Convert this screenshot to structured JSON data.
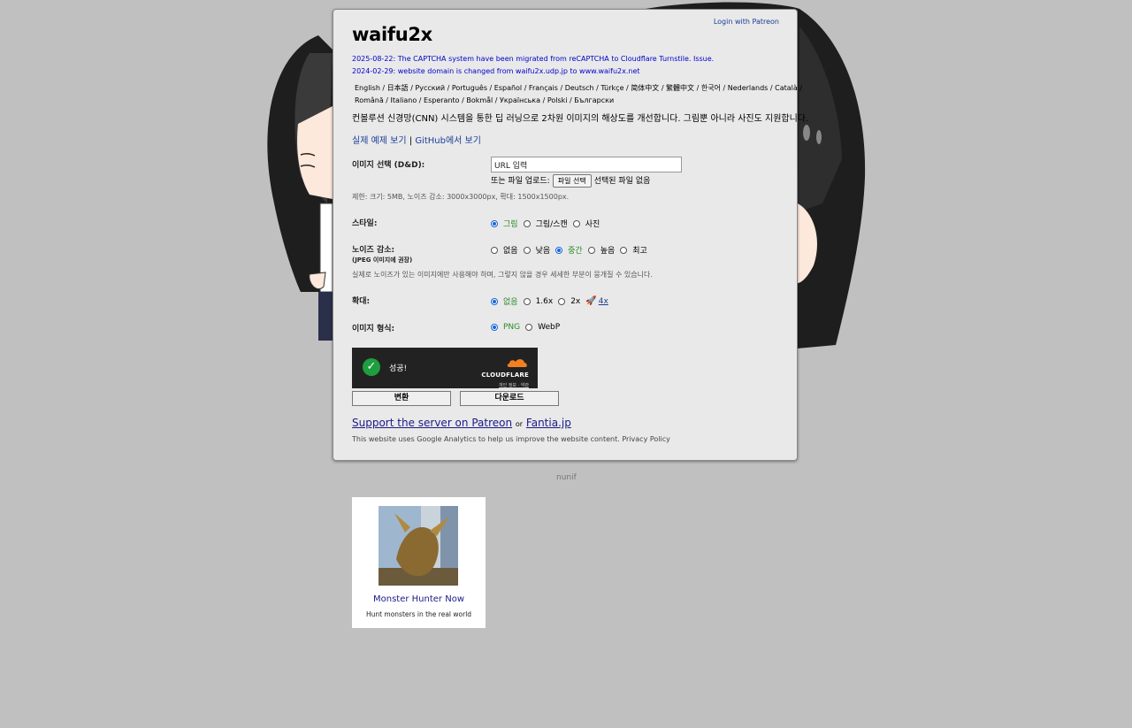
{
  "header": {
    "login_link": "Login with Patreon",
    "site_title": "waifu2x"
  },
  "news": [
    "2025-08-22: The CAPTCHA system have been migrated from reCAPTCHA to Cloudflare Turnstile. Issue.",
    "2024-02-29: website domain is changed from waifu2x.udp.jp to www.waifu2x.net"
  ],
  "languages": {
    "line1": "English / 日本語 / Русский / Português / Español / Français / Deutsch / Türkçe / 简体中文 / 繁體中文 / 한국어 / Nederlands / Català /",
    "line2": "Română / Italiano / Esperanto / Bokmål / Українська / Polski / Български"
  },
  "description": "컨볼루션 신경망(CNN) 시스템을 통한 딥 러닝으로 2차원 이미지의 해상도를 개선합니다. 그림뿐 아니라 사진도 지원합니다.",
  "links": {
    "example": "실제 예제 보기",
    "separator": "|",
    "github": "GitHub에서 보기"
  },
  "image_select": {
    "label": "이미지 선택 (D&D):",
    "url_value": "URL 입력",
    "file_prefix": "또는 파일 업로드:",
    "file_button": "파일 선택",
    "file_status": "선택된 파일 없음",
    "limits": "제한: 크기: 5MB, 노이즈 감소: 3000x3000px, 확대: 1500x1500px."
  },
  "style": {
    "label": "스타일:",
    "options": [
      "그림",
      "그림/스캔",
      "사진"
    ],
    "selected": 0
  },
  "noise": {
    "label": "노이즈 감소:",
    "sublabel": "(JPEG 이미지에 권장)",
    "options": [
      "없음",
      "낮음",
      "중간",
      "높음",
      "최고"
    ],
    "selected": 2,
    "note": "실제로 노이즈가 있는 이미지에만 사용해야 하며, 그렇지 않을 경우 세세한 부분이 뭉개질 수 있습니다."
  },
  "scale": {
    "label": "확대:",
    "options": [
      "없음",
      "1.6x",
      "2x"
    ],
    "selected": 0,
    "premium_label": "4x"
  },
  "format": {
    "label": "이미지 형식:",
    "options": [
      "PNG",
      "WebP"
    ],
    "selected": 0
  },
  "captcha": {
    "status": "성공!",
    "brand": "CLOUDFLARE",
    "links": "개인 정보 · 약관"
  },
  "buttons": {
    "convert": "변환",
    "download": "다운로드"
  },
  "support": {
    "patreon": "Support the server on Patreon",
    "or": "or",
    "fantia": "Fantia.jp"
  },
  "privacy_note": "This website uses Google Analytics to help us improve the website content. Privacy Policy",
  "footer": {
    "author": "nunif"
  },
  "ad": {
    "title": "Monster Hunter Now",
    "subtitle": "Hunt monsters in the real world"
  },
  "colors": {
    "background": "#c0c0c0",
    "panel": "#e9e9e9",
    "news_link": "#0000cc",
    "selected_option": "#2a8a2a",
    "radio_accent": "#1a66d9"
  }
}
